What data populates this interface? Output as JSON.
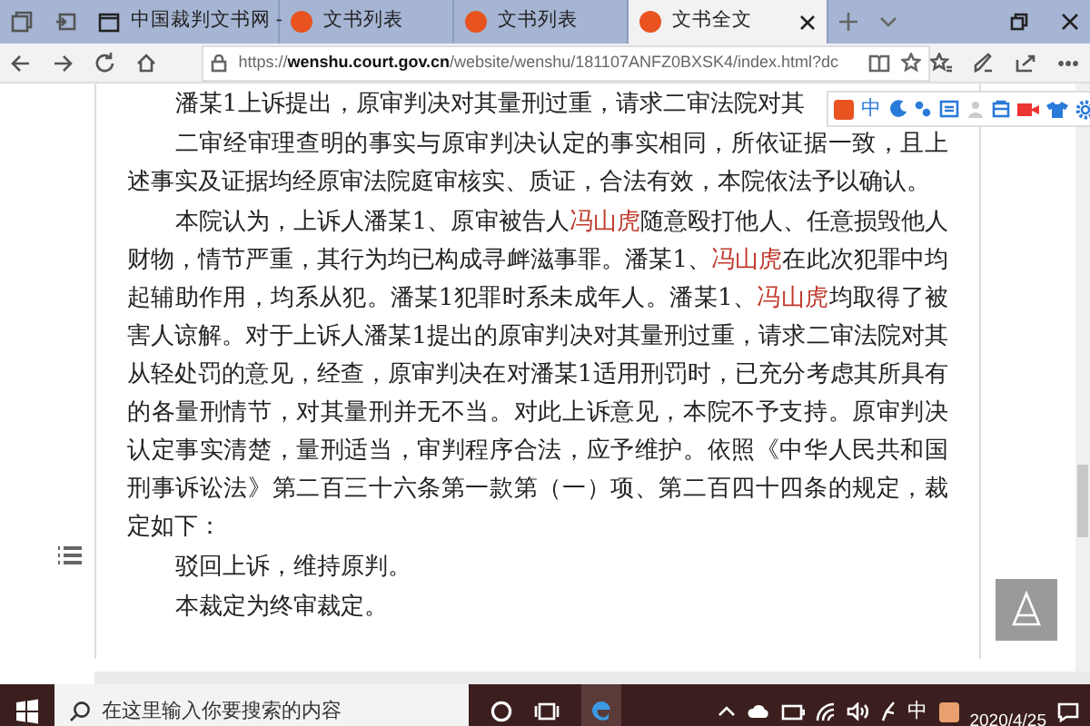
{
  "tabs": [
    {
      "label": "中国裁判文书网 -",
      "selected": false
    },
    {
      "label": "文书列表",
      "selected": false
    },
    {
      "label": "文书列表",
      "selected": false
    },
    {
      "label": "文书全文",
      "selected": true
    }
  ],
  "address_bar": {
    "scheme": "https://",
    "domain": "wenshu.court.gov.cn",
    "path": "/website/wenshu/181107ANFZ0BXSK4/index.html?dc"
  },
  "ime_toolbar": {
    "mode": "中"
  },
  "document": {
    "paragraphs": [
      {
        "segments": [
          {
            "text": "潘某1上诉提出，原审判决对其量刑过重，请求二审法院对其",
            "highlight": false
          }
        ]
      },
      {
        "segments": [
          {
            "text": "二审经审理查明的事实与原审判决认定的事实相同，所依证据一致，且上述事实及证据均经原审法院庭审核实、质证，合法有效，本院依法予以确认。",
            "highlight": false
          }
        ]
      },
      {
        "segments": [
          {
            "text": "本院认为，上诉人潘某1、原审被告人",
            "highlight": false
          },
          {
            "text": "冯山虎",
            "highlight": true
          },
          {
            "text": "随意殴打他人、任意损毁他人财物，情节严重，其行为均已构成寻衅滋事罪。潘某1、",
            "highlight": false
          },
          {
            "text": "冯山虎",
            "highlight": true
          },
          {
            "text": "在此次犯罪中均起辅助作用，均系从犯。潘某1犯罪时系未成年人。潘某1、",
            "highlight": false
          },
          {
            "text": "冯山虎",
            "highlight": true
          },
          {
            "text": "均取得了被害人谅解。对于上诉人潘某1提出的原审判决对其量刑过重，请求二审法院对其从轻处罚的意见，经查，原审判决在对潘某1适用刑罚时，已充分考虑其所具有的各量刑情节，对其量刑并无不当。对此上诉意见，本院不予支持。原审判决认定事实清楚，量刑适当，审判程序合法，应予维护。依照《中华人民共和国刑事诉讼法》第二百三十六条第一款第（一）项、第二百四十四条的规定，裁定如下：",
            "highlight": false
          }
        ]
      },
      {
        "segments": [
          {
            "text": "驳回上诉，维持原判。",
            "highlight": false
          }
        ]
      },
      {
        "segments": [
          {
            "text": "本裁定为终审裁定。",
            "highlight": false
          }
        ]
      }
    ]
  },
  "taskbar": {
    "search": {
      "placeholder": "在这里输入你要搜索的内容"
    },
    "ime": "中",
    "date": "2020/4/25"
  }
}
